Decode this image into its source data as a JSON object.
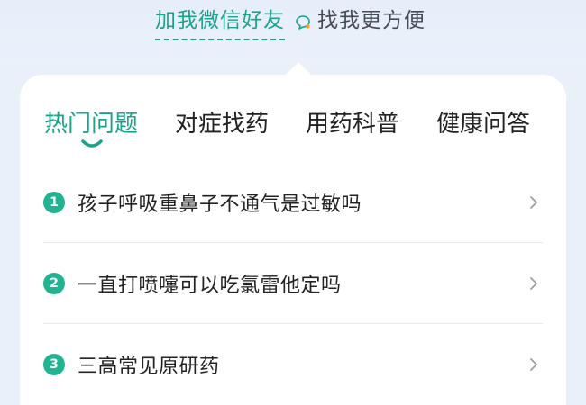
{
  "banner": {
    "link_text": "加我微信好友",
    "rest_text": "找我更方便",
    "icon": "chat-bubble-icon"
  },
  "tabs": [
    {
      "label": "热门问题",
      "active": true
    },
    {
      "label": "对症找药",
      "active": false
    },
    {
      "label": "用药科普",
      "active": false
    },
    {
      "label": "健康问答",
      "active": false
    }
  ],
  "questions": [
    {
      "number": "1",
      "text": "孩子呼吸重鼻子不通气是过敏吗"
    },
    {
      "number": "2",
      "text": "一直打喷嚏可以吃氯雷他定吗"
    },
    {
      "number": "3",
      "text": "三高常见原研药"
    }
  ],
  "colors": {
    "accent": "#1aa38a",
    "badge": "#21b392",
    "background": "#e9f0fa"
  }
}
